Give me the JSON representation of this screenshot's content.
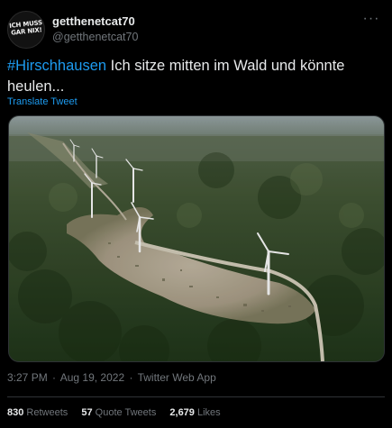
{
  "tweet": {
    "author": {
      "display_name": "getthenetcat70",
      "handle": "@getthenetcat70",
      "avatar_text": [
        "ICH MUSS",
        "GAR NIX!"
      ]
    },
    "more_icon": "more-dots-icon",
    "text": {
      "hashtag": "#Hirschhausen",
      "body": " Ich sitze mitten im Wald und könnte heulen..."
    },
    "translate_label": "Translate Tweet",
    "media": {
      "icon": "photo-icon"
    },
    "time": "3:27 PM",
    "separator": "·",
    "date": "Aug 19, 2022",
    "client": "Twitter Web App",
    "stats": {
      "retweets_count": "830",
      "retweets_label": "Retweets",
      "quotes_count": "57",
      "quotes_label": "Quote Tweets",
      "likes_count": "2,679",
      "likes_label": "Likes"
    }
  },
  "colors": {
    "background": "#000000",
    "text": "#e7e9ea",
    "secondary": "#71767b",
    "accent": "#1d9bf0",
    "border": "#2f3336"
  }
}
